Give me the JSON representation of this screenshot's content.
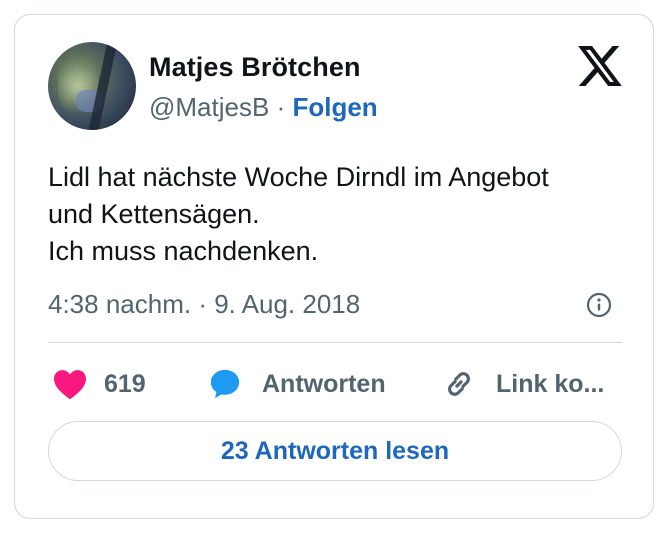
{
  "author": {
    "display_name": "Matjes Brötchen",
    "handle": "@MatjesB",
    "separator": "·",
    "follow_label": "Folgen"
  },
  "tweet": {
    "lines": [
      "Lidl hat nächste Woche Dirndl im Angebot",
      "und Kettensägen.",
      "Ich muss nachdenken."
    ],
    "timestamp": "4:38 nachm. · 9. Aug. 2018"
  },
  "actions": {
    "like_count": "619",
    "reply_label": "Antworten",
    "link_label": "Link ko..."
  },
  "read_replies_label": "23 Antworten lesen",
  "icons": {
    "logo": "x-logo-icon",
    "info": "info-icon",
    "like": "heart-icon",
    "reply": "speech-bubble-icon",
    "link": "link-icon"
  },
  "colors": {
    "accent": "#1d68bd",
    "like": "#f91880",
    "reply": "#1d9bf0",
    "muted": "#536471",
    "border": "#cfd9de"
  }
}
